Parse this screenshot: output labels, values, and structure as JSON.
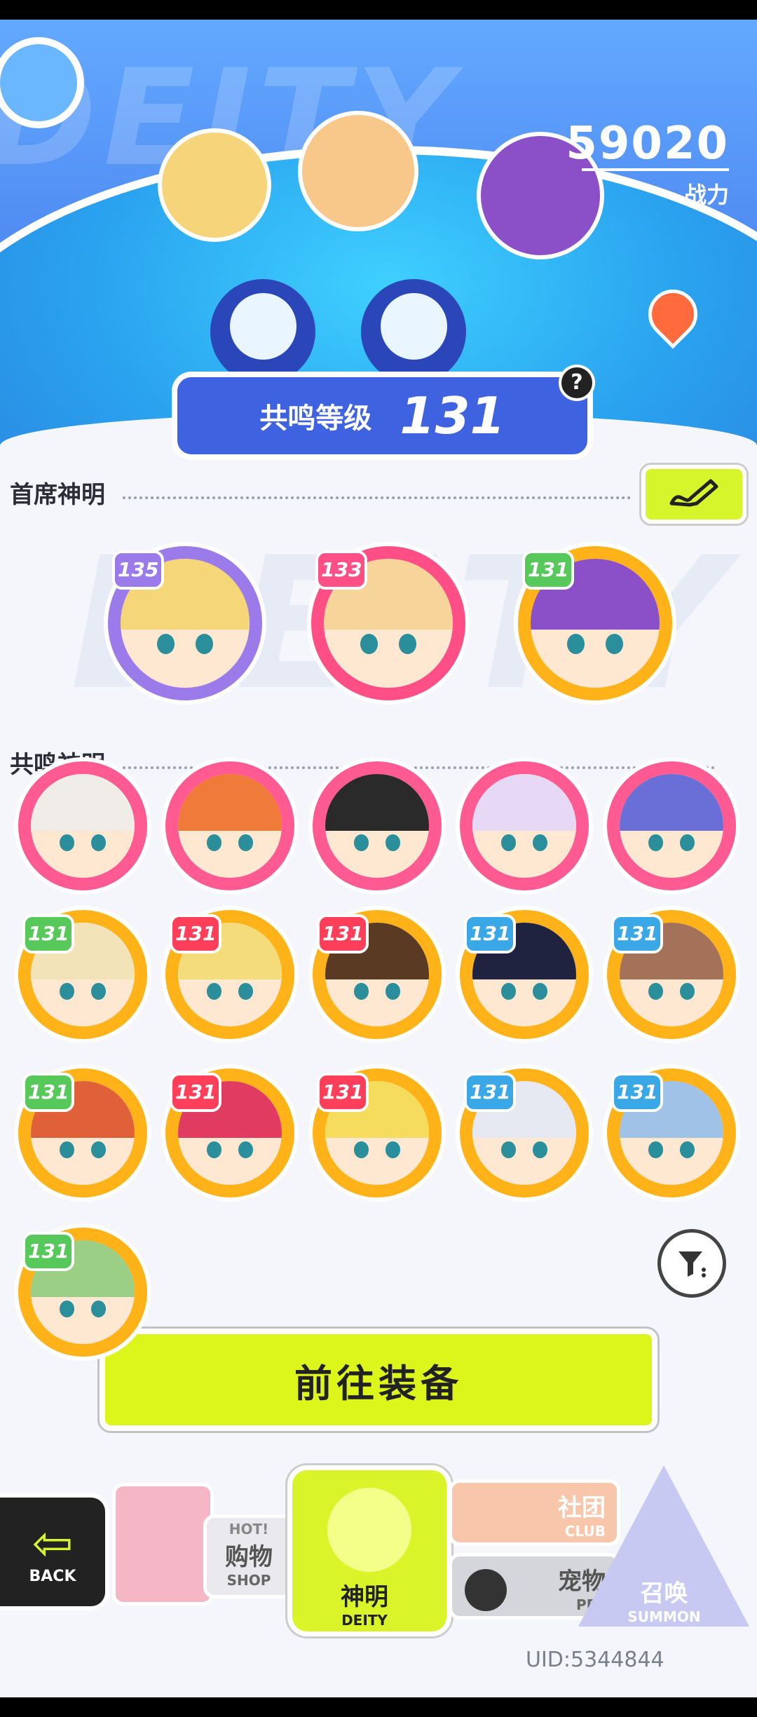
{
  "header": {
    "background_word": "DEITY",
    "power_value": "59020",
    "power_label": "战力",
    "resonance_label": "共鸣等级",
    "resonance_level": "131",
    "help_symbol": "?"
  },
  "sections": {
    "lead_title": "首席神明",
    "resonance_title": "共鸣神明",
    "background_word": "DEITY"
  },
  "lead_deities": [
    {
      "level": "135",
      "ring": "#9b7bea",
      "hair": "#f5d77a"
    },
    {
      "level": "133",
      "ring": "#ff4f86",
      "hair": "#f6d49a"
    },
    {
      "level": "131",
      "ring": "#ffb319",
      "hair": "#8b4fc7"
    }
  ],
  "resonance_deities": [
    {
      "level": "",
      "ring": "#ff5a91",
      "hair": "#f0ede8"
    },
    {
      "level": "",
      "ring": "#ff5a91",
      "hair": "#f07a3a"
    },
    {
      "level": "",
      "ring": "#ff5a91",
      "hair": "#2a2a2a"
    },
    {
      "level": "",
      "ring": "#ff5a91",
      "hair": "#e7d8f5"
    },
    {
      "level": "",
      "ring": "#ff5a91",
      "hair": "#6a6fd8"
    },
    {
      "level": "131",
      "ring": "#ffb319",
      "hair": "#f2e4b8"
    },
    {
      "level": "131",
      "ring": "#ffb319",
      "hair": "#f5dc7a"
    },
    {
      "level": "131",
      "ring": "#ffb319",
      "hair": "#5a3a22"
    },
    {
      "level": "131",
      "ring": "#ffb319",
      "hair": "#1f2340"
    },
    {
      "level": "131",
      "ring": "#ffb319",
      "hair": "#a47259"
    },
    {
      "level": "131",
      "ring": "#ffb319",
      "hair": "#e0603a"
    },
    {
      "level": "131",
      "ring": "#ffb319",
      "hair": "#e23b61"
    },
    {
      "level": "131",
      "ring": "#ffb319",
      "hair": "#f6dc5c"
    },
    {
      "level": "131",
      "ring": "#ffb319",
      "hair": "#e6e8f2"
    },
    {
      "level": "131",
      "ring": "#ffb319",
      "hair": "#9fc2e6"
    },
    {
      "level": "131",
      "ring": "#ffb319",
      "hair": "#9ccf86"
    }
  ],
  "badge_colors": {
    "level_135": "#9b7bea",
    "level_133": "#ff4f86",
    "level_131_green": "#56c95a",
    "level_131_blue": "#3aa7e6",
    "level_131_red": "#ff3f5a"
  },
  "actions": {
    "equip_label": "前往装备"
  },
  "nav": {
    "back": "BACK",
    "shop_badge": "HOT!",
    "shop_cn": "购物",
    "shop_en": "SHOP",
    "deity_cn": "神明",
    "deity_en": "DEITY",
    "club_cn": "社团",
    "club_en": "CLUB",
    "pet_cn": "宠物",
    "pet_en": "PET",
    "summon_cn": "召唤",
    "summon_en": "SUMMON"
  },
  "footer": {
    "uid": "UID:5344844"
  },
  "colors": {
    "accent_lime": "#dcf51b",
    "primary_blue": "#3f63e0"
  }
}
